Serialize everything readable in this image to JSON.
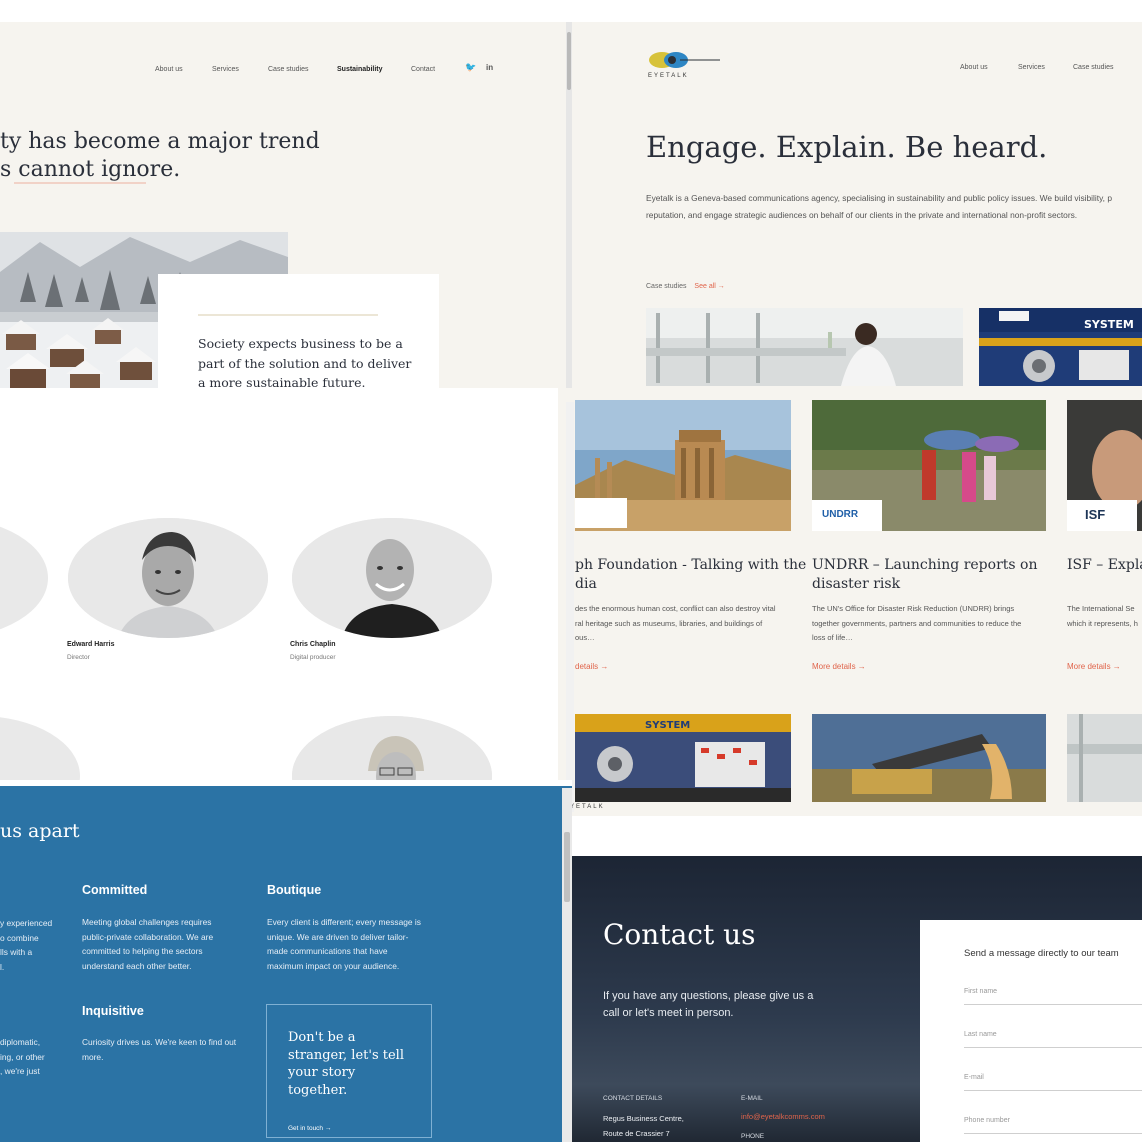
{
  "sustainability": {
    "nav": [
      "About us",
      "Services",
      "Case studies",
      "Sustainability",
      "Contact"
    ],
    "headline_line1": "ty has become a major trend",
    "headline_line2": "s cannot ignore.",
    "quote_line1": "Society expects business to be a",
    "quote_line2": "part of the solution and to deliver",
    "quote_line3": "a more sustainable future."
  },
  "home": {
    "logo_text": "EYETALK",
    "nav": [
      "About us",
      "Services",
      "Case studies"
    ],
    "hero_title": "Engage. Explain. Be heard.",
    "intro_line1": "Eyetalk is a Geneva-based communications agency, specialising in sustainability and public policy issues. We build visibility, p",
    "intro_line2": "reputation, and engage strategic audiences on behalf of our clients in the private and international non-profit sectors.",
    "case_label": "Case studies",
    "see_all": "See all →"
  },
  "team": {
    "members": [
      {
        "name": "Edward Harris",
        "role": "Director"
      },
      {
        "name": "Chris Chaplin",
        "role": "Digital producer"
      }
    ]
  },
  "cases": {
    "items": [
      {
        "title_line1": "ph Foundation - Talking with the",
        "title_line2": "dia",
        "desc_line1": "des the enormous human cost, conflict can also destroy vital",
        "desc_line2": "ral heritage such as museums, libraries, and buildings of",
        "desc_line3": "ous…",
        "more": "details →",
        "badge": ""
      },
      {
        "title_line1": "UNDRR – Launching reports on",
        "title_line2": "disaster risk",
        "desc_line1": "The UN's Office for Disaster Risk Reduction (UNDRR) brings",
        "desc_line2": "together governments, partners and communities to reduce the",
        "desc_line3": "loss of life…",
        "more": "More details →",
        "badge": "UNDRR"
      },
      {
        "title_line1": "ISF – Explai",
        "title_line2": "",
        "desc_line1": "The International Se",
        "desc_line2": "which it represents, h",
        "desc_line3": "",
        "more": "More details →",
        "badge": "ISF"
      }
    ],
    "footer_logo": "YETALK"
  },
  "apart": {
    "heading": "us apart",
    "committed_title": "Committed",
    "committed_lines": [
      "Meeting global challenges requires",
      "public-private collaboration. We are",
      "committed to helping the sectors",
      "understand each other better."
    ],
    "boutique_title": "Boutique",
    "boutique_lines": [
      "Every client is different; every message is",
      "unique. We are driven to deliver tailor-",
      "made communications that have",
      "maximum impact on your audience."
    ],
    "inquisitive_title": "Inquisitive",
    "inquisitive_lines": [
      "Curiosity drives us. We're keen to find out",
      "more."
    ],
    "left_lines_top": [
      "y experienced",
      "o combine",
      "lls with a",
      "l."
    ],
    "left_lines_bottom": [
      "diplomatic,",
      "ing, or other",
      ", we're just"
    ],
    "cta_lines": [
      "Don't be a",
      "stranger, let's tell",
      "your story",
      "together."
    ],
    "cta_link": "Get in touch →"
  },
  "contact": {
    "title": "Contact us",
    "text_line1": "If you have any questions, please give us a",
    "text_line2": "call or let's meet in person.",
    "details_label": "CONTACT DETAILS",
    "address_line1": "Regus Business Centre,",
    "address_line2": "Route de Crassier 7",
    "email_label": "E-MAIL",
    "email": "info@eyetalkcomms.com",
    "phone_label": "PHONE",
    "form_title": "Send a message directly to our team",
    "fields": [
      "First name",
      "Last name",
      "E-mail",
      "Phone number"
    ]
  },
  "colors": {
    "accent": "#e0644b",
    "blue": "#2b73a5",
    "beige": "#f6f4ef",
    "navy": "#1c2534"
  }
}
